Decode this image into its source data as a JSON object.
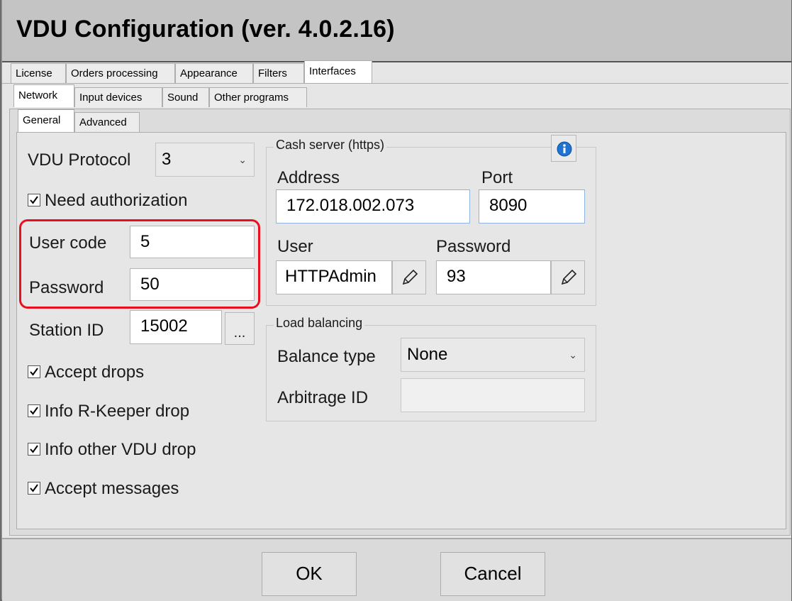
{
  "window": {
    "title": "VDU Configuration (ver. 4.0.2.16)"
  },
  "tabs_main": [
    {
      "label": "License"
    },
    {
      "label": "Orders processing"
    },
    {
      "label": "Appearance"
    },
    {
      "label": "Filters"
    },
    {
      "label": "Interfaces"
    }
  ],
  "tabs_interfaces": [
    {
      "label": "Network"
    },
    {
      "label": "Input devices"
    },
    {
      "label": "Sound"
    },
    {
      "label": "Other programs"
    }
  ],
  "tabs_network": [
    {
      "label": "General"
    },
    {
      "label": "Advanced"
    }
  ],
  "general": {
    "vdu_protocol_label": "VDU Protocol",
    "vdu_protocol_value": "3",
    "need_authorization": "Need authorization",
    "user_code_label": "User code",
    "user_code_value": "5",
    "password_label": "Password",
    "password_value": "50",
    "station_id_label": "Station ID",
    "station_id_value": "15002",
    "station_id_button": "...",
    "accept_drops": "Accept drops",
    "info_rkeeper_drop": "Info R-Keeper drop",
    "info_other_vdu_drop": "Info other VDU drop",
    "accept_messages": "Accept messages"
  },
  "cash_server": {
    "group_label": "Cash server (https)",
    "address_label": "Address",
    "address_value": "172.018.002.073",
    "port_label": "Port",
    "port_value": "8090",
    "user_label": "User",
    "user_value": "HTTPAdmin",
    "password_label": "Password",
    "password_value": "93"
  },
  "load_balancing": {
    "group_label": "Load balancing",
    "balance_type_label": "Balance type",
    "balance_type_value": "None",
    "arbitrage_id_label": "Arbitrage ID",
    "arbitrage_id_value": ""
  },
  "footer": {
    "ok_label": "OK",
    "cancel_label": "Cancel"
  },
  "colors": {
    "highlight": "#e8101e",
    "info_icon": "#1e74d0"
  },
  "icons": [
    "info-icon",
    "pencil-icon",
    "chevron-down-icon",
    "checkmark-icon"
  ]
}
